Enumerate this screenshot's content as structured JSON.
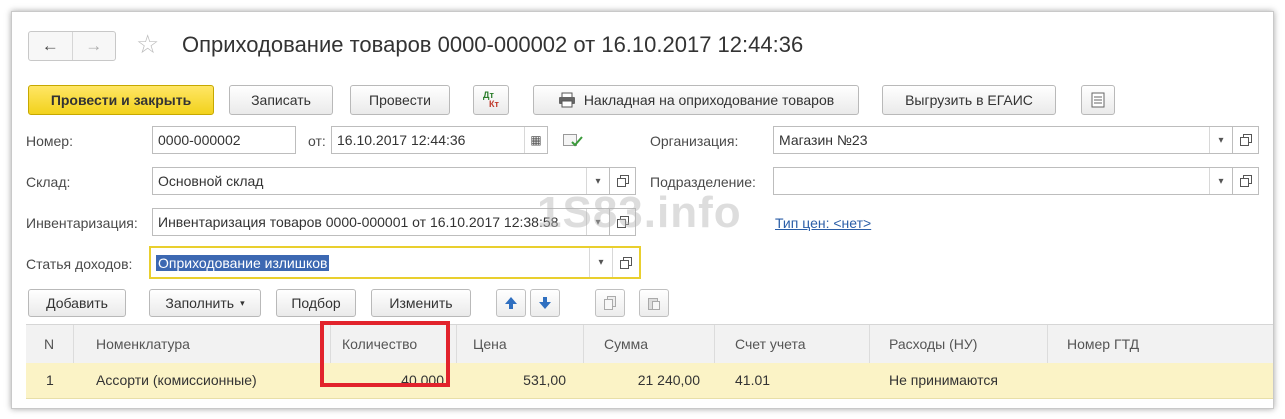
{
  "window": {
    "nav_back": "←",
    "nav_forward": "→",
    "favorite_icon": "star-icon",
    "title": "Оприходование товаров 0000-000002 от 16.10.2017 12:44:36"
  },
  "toolbar": {
    "post_close": "Провести и закрыть",
    "save": "Записать",
    "post": "Провести",
    "dtkt_top": "Дт",
    "dtkt_bottom": "Кт",
    "print_label": "Накладная на оприходование товаров",
    "egais": "Выгрузить в ЕГАИС"
  },
  "form": {
    "number_label": "Номер:",
    "number_value": "0000-000002",
    "date_label": "от:",
    "date_value": "16.10.2017 12:44:36",
    "org_label": "Организация:",
    "org_value": "Магазин №23",
    "warehouse_label": "Склад:",
    "warehouse_value": "Основной склад",
    "division_label": "Подразделение:",
    "division_value": "",
    "inventory_label": "Инвентаризация:",
    "inventory_value": "Инвентаризация товаров 0000-000001 от 16.10.2017 12:38:58",
    "price_type_link": "Тип цен: <нет>",
    "income_label": "Статья доходов:",
    "income_value": "Оприходование излишков"
  },
  "watermark": "1S83.info",
  "table_toolbar": {
    "add": "Добавить",
    "fill": "Заполнить",
    "select": "Подбор",
    "edit": "Изменить"
  },
  "table": {
    "columns": [
      "N",
      "Номенклатура",
      "Количество",
      "Цена",
      "Сумма",
      "Счет учета",
      "Расходы (НУ)",
      "Номер ГТД"
    ],
    "rows": [
      [
        "1",
        "Ассорти (комиссионные)",
        "40,000",
        "531,00",
        "21 240,00",
        "41.01",
        "Не принимаются",
        ""
      ]
    ]
  },
  "colors": {
    "primary_button": "#f2d21c",
    "highlight_box": "#e2232c",
    "selected_row": "#fbf3c6",
    "link": "#2b5ea7"
  }
}
